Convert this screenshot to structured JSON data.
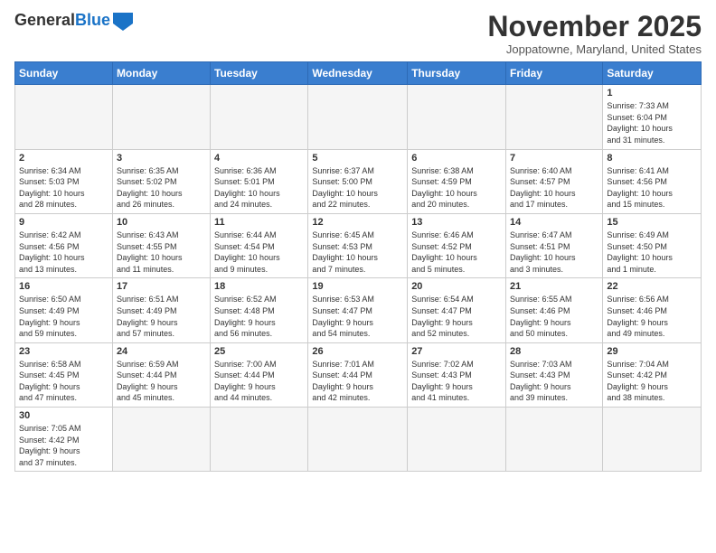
{
  "header": {
    "logo_general": "General",
    "logo_blue": "Blue",
    "month_title": "November 2025",
    "subtitle": "Joppatowne, Maryland, United States"
  },
  "weekdays": [
    "Sunday",
    "Monday",
    "Tuesday",
    "Wednesday",
    "Thursday",
    "Friday",
    "Saturday"
  ],
  "weeks": [
    [
      {
        "day": "",
        "info": ""
      },
      {
        "day": "",
        "info": ""
      },
      {
        "day": "",
        "info": ""
      },
      {
        "day": "",
        "info": ""
      },
      {
        "day": "",
        "info": ""
      },
      {
        "day": "",
        "info": ""
      },
      {
        "day": "1",
        "info": "Sunrise: 7:33 AM\nSunset: 6:04 PM\nDaylight: 10 hours\nand 31 minutes."
      }
    ],
    [
      {
        "day": "2",
        "info": "Sunrise: 6:34 AM\nSunset: 5:03 PM\nDaylight: 10 hours\nand 28 minutes."
      },
      {
        "day": "3",
        "info": "Sunrise: 6:35 AM\nSunset: 5:02 PM\nDaylight: 10 hours\nand 26 minutes."
      },
      {
        "day": "4",
        "info": "Sunrise: 6:36 AM\nSunset: 5:01 PM\nDaylight: 10 hours\nand 24 minutes."
      },
      {
        "day": "5",
        "info": "Sunrise: 6:37 AM\nSunset: 5:00 PM\nDaylight: 10 hours\nand 22 minutes."
      },
      {
        "day": "6",
        "info": "Sunrise: 6:38 AM\nSunset: 4:59 PM\nDaylight: 10 hours\nand 20 minutes."
      },
      {
        "day": "7",
        "info": "Sunrise: 6:40 AM\nSunset: 4:57 PM\nDaylight: 10 hours\nand 17 minutes."
      },
      {
        "day": "8",
        "info": "Sunrise: 6:41 AM\nSunset: 4:56 PM\nDaylight: 10 hours\nand 15 minutes."
      }
    ],
    [
      {
        "day": "9",
        "info": "Sunrise: 6:42 AM\nSunset: 4:56 PM\nDaylight: 10 hours\nand 13 minutes."
      },
      {
        "day": "10",
        "info": "Sunrise: 6:43 AM\nSunset: 4:55 PM\nDaylight: 10 hours\nand 11 minutes."
      },
      {
        "day": "11",
        "info": "Sunrise: 6:44 AM\nSunset: 4:54 PM\nDaylight: 10 hours\nand 9 minutes."
      },
      {
        "day": "12",
        "info": "Sunrise: 6:45 AM\nSunset: 4:53 PM\nDaylight: 10 hours\nand 7 minutes."
      },
      {
        "day": "13",
        "info": "Sunrise: 6:46 AM\nSunset: 4:52 PM\nDaylight: 10 hours\nand 5 minutes."
      },
      {
        "day": "14",
        "info": "Sunrise: 6:47 AM\nSunset: 4:51 PM\nDaylight: 10 hours\nand 3 minutes."
      },
      {
        "day": "15",
        "info": "Sunrise: 6:49 AM\nSunset: 4:50 PM\nDaylight: 10 hours\nand 1 minute."
      }
    ],
    [
      {
        "day": "16",
        "info": "Sunrise: 6:50 AM\nSunset: 4:49 PM\nDaylight: 9 hours\nand 59 minutes."
      },
      {
        "day": "17",
        "info": "Sunrise: 6:51 AM\nSunset: 4:49 PM\nDaylight: 9 hours\nand 57 minutes."
      },
      {
        "day": "18",
        "info": "Sunrise: 6:52 AM\nSunset: 4:48 PM\nDaylight: 9 hours\nand 56 minutes."
      },
      {
        "day": "19",
        "info": "Sunrise: 6:53 AM\nSunset: 4:47 PM\nDaylight: 9 hours\nand 54 minutes."
      },
      {
        "day": "20",
        "info": "Sunrise: 6:54 AM\nSunset: 4:47 PM\nDaylight: 9 hours\nand 52 minutes."
      },
      {
        "day": "21",
        "info": "Sunrise: 6:55 AM\nSunset: 4:46 PM\nDaylight: 9 hours\nand 50 minutes."
      },
      {
        "day": "22",
        "info": "Sunrise: 6:56 AM\nSunset: 4:46 PM\nDaylight: 9 hours\nand 49 minutes."
      }
    ],
    [
      {
        "day": "23",
        "info": "Sunrise: 6:58 AM\nSunset: 4:45 PM\nDaylight: 9 hours\nand 47 minutes."
      },
      {
        "day": "24",
        "info": "Sunrise: 6:59 AM\nSunset: 4:44 PM\nDaylight: 9 hours\nand 45 minutes."
      },
      {
        "day": "25",
        "info": "Sunrise: 7:00 AM\nSunset: 4:44 PM\nDaylight: 9 hours\nand 44 minutes."
      },
      {
        "day": "26",
        "info": "Sunrise: 7:01 AM\nSunset: 4:44 PM\nDaylight: 9 hours\nand 42 minutes."
      },
      {
        "day": "27",
        "info": "Sunrise: 7:02 AM\nSunset: 4:43 PM\nDaylight: 9 hours\nand 41 minutes."
      },
      {
        "day": "28",
        "info": "Sunrise: 7:03 AM\nSunset: 4:43 PM\nDaylight: 9 hours\nand 39 minutes."
      },
      {
        "day": "29",
        "info": "Sunrise: 7:04 AM\nSunset: 4:42 PM\nDaylight: 9 hours\nand 38 minutes."
      }
    ],
    [
      {
        "day": "30",
        "info": "Sunrise: 7:05 AM\nSunset: 4:42 PM\nDaylight: 9 hours\nand 37 minutes."
      },
      {
        "day": "",
        "info": ""
      },
      {
        "day": "",
        "info": ""
      },
      {
        "day": "",
        "info": ""
      },
      {
        "day": "",
        "info": ""
      },
      {
        "day": "",
        "info": ""
      },
      {
        "day": "",
        "info": ""
      }
    ]
  ]
}
